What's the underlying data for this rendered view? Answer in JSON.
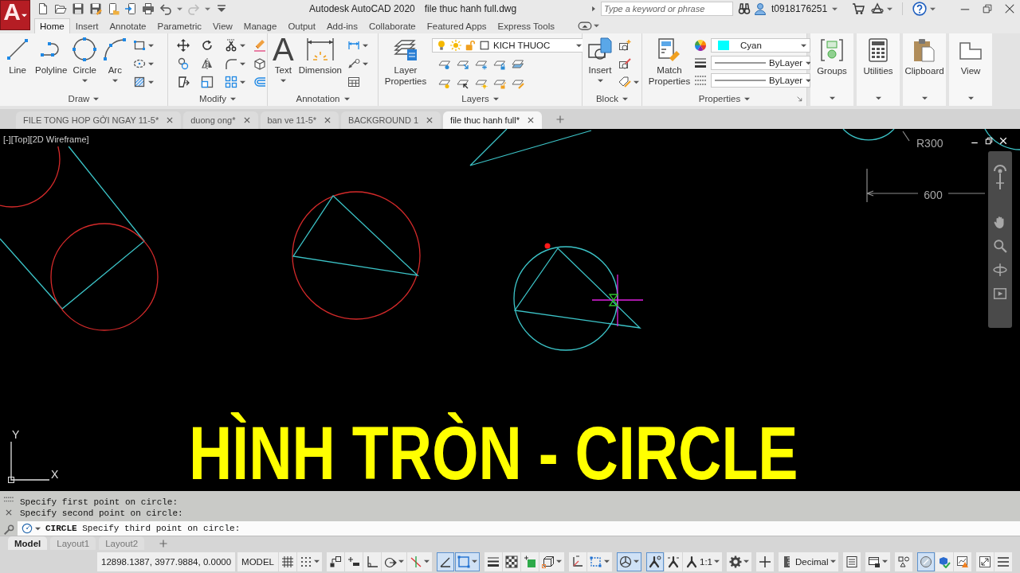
{
  "app_menu": {
    "label": "A"
  },
  "title_bar": {
    "app_name": "Autodesk AutoCAD 2020",
    "file_name": "file thuc hanh full.dwg",
    "search": {
      "placeholder": "Type a keyword or phrase"
    },
    "user_name": "t0918176251"
  },
  "ribbon_tabs": [
    {
      "label": "Home",
      "selected": true
    },
    {
      "label": "Insert",
      "selected": false
    },
    {
      "label": "Annotate",
      "selected": false
    },
    {
      "label": "Parametric",
      "selected": false
    },
    {
      "label": "View",
      "selected": false
    },
    {
      "label": "Manage",
      "selected": false
    },
    {
      "label": "Output",
      "selected": false
    },
    {
      "label": "Add-ins",
      "selected": false
    },
    {
      "label": "Collaborate",
      "selected": false
    },
    {
      "label": "Featured Apps",
      "selected": false
    },
    {
      "label": "Express Tools",
      "selected": false
    }
  ],
  "ribbon": {
    "draw": {
      "title": "Draw",
      "tools": [
        {
          "kind": "line",
          "label": "Line"
        },
        {
          "kind": "polyline",
          "label": "Polyline"
        },
        {
          "kind": "circle",
          "label": "Circle"
        },
        {
          "kind": "arc",
          "label": "Arc"
        }
      ]
    },
    "modify": {
      "title": "Modify"
    },
    "annotation": {
      "title": "Annotation",
      "text_tool": {
        "glyph": "A",
        "label": "Text"
      },
      "dimension_tool": {
        "label": "Dimension"
      }
    },
    "layers": {
      "title": "Layers",
      "layer_properties": "Layer Properties",
      "current_layer": "KICH THUOC"
    },
    "block": {
      "title": "Block",
      "insert": "Insert"
    },
    "properties": {
      "title": "Properties",
      "match_properties": "Match Properties",
      "color": {
        "value": "Cyan",
        "color": "#00ffff"
      },
      "lineweight": "ByLayer",
      "linetype": "ByLayer"
    },
    "extra_panels": [
      {
        "kind": "groups",
        "label": "Groups"
      },
      {
        "kind": "utilities",
        "label": "Utilities"
      },
      {
        "kind": "clipboard",
        "label": "Clipboard"
      },
      {
        "kind": "view",
        "label": "View"
      }
    ]
  },
  "document_tabs": [
    {
      "label": "FILE TONG HOP GỞI NGAY 11-5*",
      "selected": false
    },
    {
      "label": "duong ong*",
      "selected": false
    },
    {
      "label": "ban ve 11-5*",
      "selected": false
    },
    {
      "label": "BACKGROUND 1",
      "selected": false
    },
    {
      "label": "file thuc hanh full*",
      "selected": true
    }
  ],
  "viewport": {
    "label": "[-][Top][2D Wireframe]",
    "radius_dimension": "R300",
    "length_dimension": "600",
    "ucs": {
      "y": "Y",
      "x": "X"
    },
    "caption": "HÌNH TRÒN - CIRCLE"
  },
  "command_line": {
    "history": [
      "Specify first point on circle:",
      "Specify second point on circle:"
    ],
    "prompt": "**CIRCLE** Specify third point on circle:"
  },
  "layout_tabs": [
    {
      "label": "Model",
      "selected": true
    },
    {
      "label": "Layout1",
      "selected": false
    },
    {
      "label": "Layout2",
      "selected": false
    }
  ],
  "status_bar": {
    "coordinates": "12898.1387, 3977.9884, 0.0000",
    "space": "MODEL",
    "tools": [
      {
        "kind": "grid",
        "on": false
      },
      {
        "kind": "snap",
        "on": false
      },
      {
        "kind": "infer-constraints",
        "on": false
      },
      {
        "kind": "dynamic-input",
        "on": false
      },
      {
        "kind": "ortho",
        "on": false
      },
      {
        "kind": "polar",
        "on": false
      },
      {
        "kind": "isodraft",
        "on": false
      },
      {
        "kind": "snap-tracking",
        "on": true
      },
      {
        "kind": "object-snap",
        "on": true
      },
      {
        "kind": "lineweight",
        "on": false
      },
      {
        "kind": "transparency",
        "on": false
      },
      {
        "kind": "selection-cycling",
        "on": false
      },
      {
        "kind": "osnap-3d",
        "on": false
      },
      {
        "kind": "dynamic-ucs",
        "on": false
      },
      {
        "kind": "selection-filter",
        "on": false
      },
      {
        "kind": "gizmo",
        "on": true
      },
      {
        "kind": "annotation-visibility",
        "on": true
      },
      {
        "kind": "autoscale",
        "on": false
      },
      {
        "kind": "annotation-scale",
        "label": "1:1"
      },
      {
        "kind": "workspace"
      },
      {
        "kind": "annotation-monitor"
      },
      {
        "kind": "units",
        "label": "Decimal"
      },
      {
        "kind": "quick-properties",
        "on": false
      },
      {
        "kind": "lock-ui"
      },
      {
        "kind": "isolate"
      },
      {
        "kind": "hardware-acceleration",
        "on": true
      },
      {
        "kind": "graphics-performance"
      },
      {
        "kind": "performance-warning"
      },
      {
        "kind": "clean-screen"
      },
      {
        "kind": "customization"
      }
    ]
  }
}
